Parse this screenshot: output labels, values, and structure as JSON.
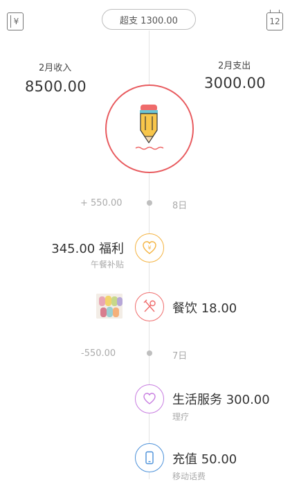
{
  "header": {
    "left_icon": "currency-ledger-icon",
    "left_icon_glyph": "¥",
    "overspend_label": "超支 1300.00",
    "right_icon": "calendar-icon",
    "right_icon_day": "12"
  },
  "summary": {
    "income_label": "2月收入",
    "income_value": "8500.00",
    "expense_label": "2月支出",
    "expense_value": "3000.00",
    "center_icon": "pencil-icon"
  },
  "timeline": {
    "day8": {
      "income_total": "+ 550.00",
      "date": "8日"
    },
    "entry_welfare": {
      "icon": "yen-heart-icon",
      "text": "345.00 福利",
      "note": "午餐补贴",
      "color": "#f4b23e"
    },
    "entry_dining": {
      "icon": "fork-spoon-icon",
      "text": "餐饮 18.00",
      "color": "#ef6b6b",
      "has_photo": true
    },
    "day7": {
      "expense_total": "-550.00",
      "date": "7日"
    },
    "entry_service": {
      "icon": "heart-icon",
      "text": "生活服务 300.00",
      "note": "理疗",
      "color": "#c77be0"
    },
    "entry_recharge": {
      "icon": "phone-icon",
      "text": "充值 50.00",
      "note": "移动话费",
      "color": "#4a90d9"
    }
  }
}
